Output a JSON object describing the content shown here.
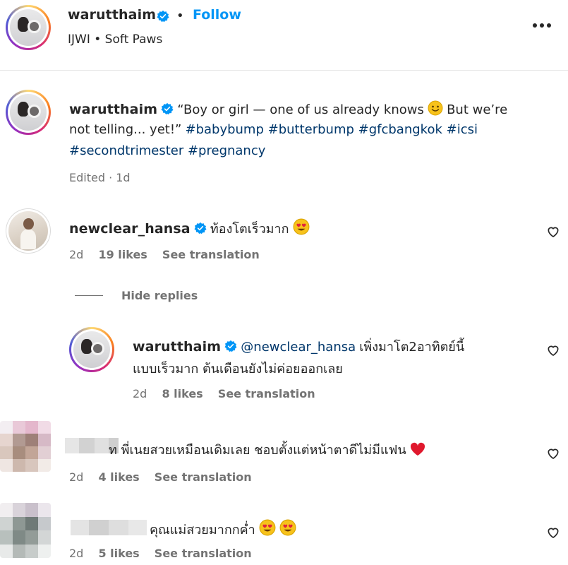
{
  "post_header": {
    "username": "warutthaim",
    "separator": "•",
    "follow_label": "Follow",
    "audio": "IJWI • Soft Paws",
    "more_icon": "more-horizontal-icon"
  },
  "caption": {
    "username": "warutthaim",
    "text_line1": "“Boy or girl — one of us already knows",
    "text_line1b": "But we’re",
    "text_line2a": "not telling... yet!”",
    "hashtags_line2": "#babybump #butterbump #gfcbangkok #icsi",
    "hashtags_line3": "#secondtrimester #pregnancy",
    "meta": "Edited · 1d"
  },
  "comments": [
    {
      "username": "newclear_hansa",
      "text": "ท้องโตเร็วมาก",
      "time": "2d",
      "likes": "19 likes",
      "translation": "See translation"
    }
  ],
  "hide_replies": "Hide replies",
  "reply": {
    "username": "warutthaim",
    "mention": "@newclear_hansa",
    "text_line1": "เพิ่งมาโต2อาทิตย์นี้",
    "text_line2": "แบบเร็วมาก ต้นเดือนยังไม่ค่อยออกเลย",
    "time": "2d",
    "likes": "8 likes",
    "translation": "See translation"
  },
  "comment3": {
    "text": "ท พี่เนยสวยเหมือนเดิมเลย ชอบตั้งแต่หน้าตาดีไม่มีแฟน",
    "time": "2d",
    "likes": "4 likes",
    "translation": "See translation"
  },
  "comment4": {
    "text": "คุณแม่สวยมากกค่ำ",
    "time": "2d",
    "likes": "5 likes",
    "translation": "See translation"
  },
  "colors": {
    "link_blue": "#0095f6",
    "verified_blue": "#0095f6",
    "hashtag": "#00376b",
    "muted": "#737373"
  }
}
